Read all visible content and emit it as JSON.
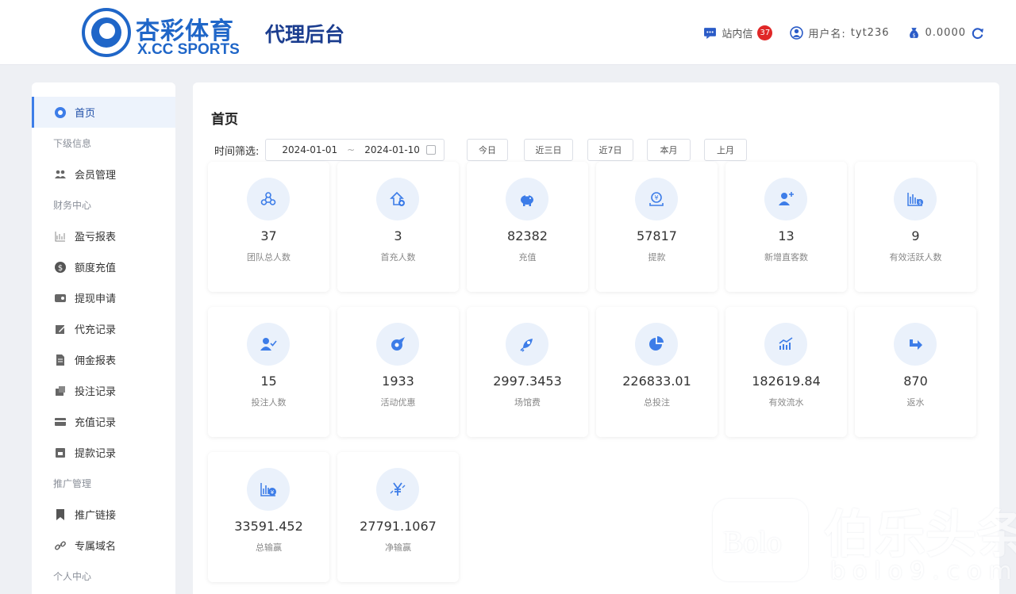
{
  "header": {
    "logo_cn": "杏彩体育",
    "logo_en": "X.CC SPORTS",
    "title": "代理后台",
    "messages_label": "站内信",
    "messages_count": "37",
    "username_label": "用户名:",
    "username": "tyt236",
    "balance": "0.0000"
  },
  "sidebar": {
    "items": [
      {
        "type": "item",
        "label": "首页",
        "icon": "home-icon",
        "active": true
      },
      {
        "type": "head",
        "label": "下级信息"
      },
      {
        "type": "item",
        "label": "会员管理",
        "icon": "members-icon"
      },
      {
        "type": "head",
        "label": "财务中心"
      },
      {
        "type": "item",
        "label": "盈亏报表",
        "icon": "chart-icon"
      },
      {
        "type": "item",
        "label": "额度充值",
        "icon": "dollar-icon"
      },
      {
        "type": "item",
        "label": "提现申请",
        "icon": "withdraw-icon"
      },
      {
        "type": "item",
        "label": "代充记录",
        "icon": "edit-icon"
      },
      {
        "type": "item",
        "label": "佣金报表",
        "icon": "document-icon"
      },
      {
        "type": "item",
        "label": "投注记录",
        "icon": "bet-icon"
      },
      {
        "type": "item",
        "label": "充值记录",
        "icon": "card-icon"
      },
      {
        "type": "item",
        "label": "提款记录",
        "icon": "cashbox-icon"
      },
      {
        "type": "head",
        "label": "推广管理"
      },
      {
        "type": "item",
        "label": "推广链接",
        "icon": "bookmark-icon"
      },
      {
        "type": "item",
        "label": "专属域名",
        "icon": "link-icon"
      },
      {
        "type": "head",
        "label": "个人中心"
      }
    ]
  },
  "main": {
    "title": "首页",
    "filter_label": "时间筛选:",
    "date_start": "2024-01-01",
    "date_sep": "~",
    "date_end": "2024-01-10",
    "quick_buttons": [
      "今日",
      "近三日",
      "近7日",
      "本月",
      "上月"
    ],
    "cards": [
      {
        "value": "37",
        "label": "团队总人数",
        "icon": "team-icon"
      },
      {
        "value": "3",
        "label": "首充人数",
        "icon": "first-deposit-icon"
      },
      {
        "value": "82382",
        "label": "充值",
        "icon": "piggy-bank-icon"
      },
      {
        "value": "57817",
        "label": "提款",
        "icon": "withdraw-icon"
      },
      {
        "value": "13",
        "label": "新增直客数",
        "icon": "add-user-icon"
      },
      {
        "value": "9",
        "label": "有效活跃人数",
        "icon": "active-chart-icon"
      },
      {
        "value": "15",
        "label": "投注人数",
        "icon": "user-check-icon"
      },
      {
        "value": "1933",
        "label": "活动优惠",
        "icon": "promo-icon"
      },
      {
        "value": "2997.3453",
        "label": "场馆费",
        "icon": "rocket-icon"
      },
      {
        "value": "226833.01",
        "label": "总投注",
        "icon": "pie-icon"
      },
      {
        "value": "182619.84",
        "label": "有效流水",
        "icon": "trend-icon"
      },
      {
        "value": "870",
        "label": "返水",
        "icon": "return-icon"
      },
      {
        "value": "33591.452",
        "label": "总输赢",
        "icon": "winloss-chart-icon"
      },
      {
        "value": "27791.1067",
        "label": "净输赢",
        "icon": "yen-icon"
      }
    ]
  },
  "watermark": {
    "logo_text": "Bolo",
    "cn": "伯乐头条",
    "url": "bolo9.com"
  },
  "colors": {
    "accent": "#3d7de8",
    "brand": "#1f66c8",
    "badge": "#e02727",
    "icon_bg": "#eaf1fb"
  }
}
